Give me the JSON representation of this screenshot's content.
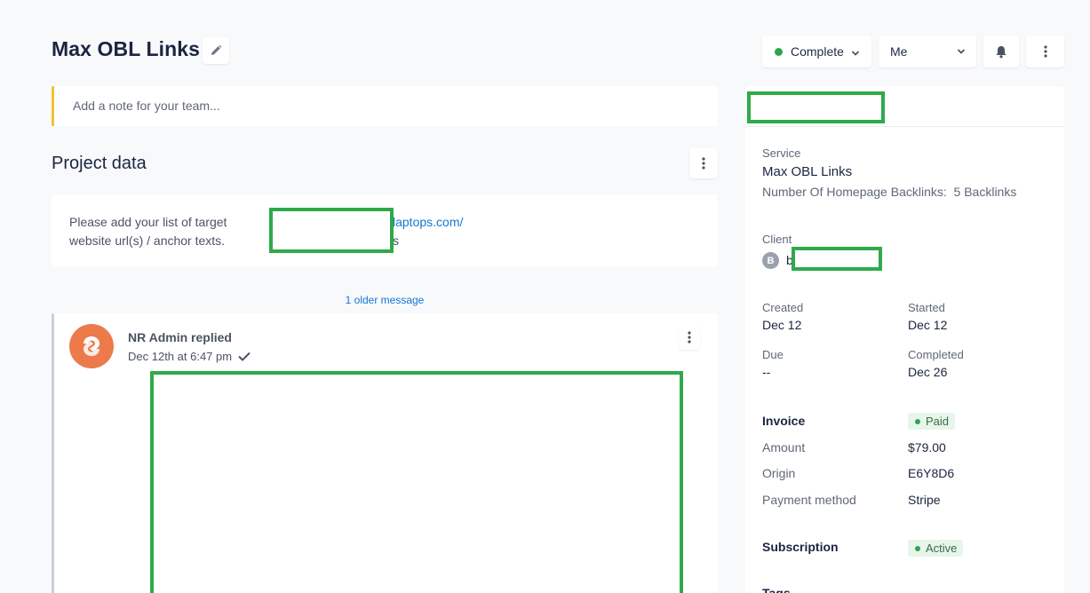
{
  "header": {
    "title": "Max OBL Links",
    "status_label": "Complete",
    "assignee_label": "Me"
  },
  "note": {
    "placeholder": "Add a note for your team..."
  },
  "project": {
    "title": "Project data",
    "question": "Please add your list of target website url(s) / anchor texts.",
    "answer_link_tail": "laptops.com/",
    "answer_line2_tail": "s"
  },
  "thread": {
    "older_label": "1 older message",
    "author": "NR Admin replied",
    "time": "Dec 12th at 6:47 pm"
  },
  "sidebar": {
    "service_label": "Service",
    "service_name": "Max OBL Links",
    "service_option": "Number Of Homepage Backlinks:  5 Backlinks",
    "client_label": "Client",
    "client_initial": "B",
    "client_name_start": "b",
    "created_label": "Created",
    "created_value": "Dec 12",
    "started_label": "Started",
    "started_value": "Dec 12",
    "due_label": "Due",
    "due_value": "--",
    "completed_label": "Completed",
    "completed_value": "Dec 26",
    "invoice_label": "Invoice",
    "invoice_status": "Paid",
    "amount_label": "Amount",
    "amount_value": "$79.00",
    "origin_label": "Origin",
    "origin_value": "E6Y8D6",
    "payment_label": "Payment method",
    "payment_value": "Stripe",
    "subscription_label": "Subscription",
    "subscription_status": "Active",
    "tags_label": "Tags"
  },
  "colors": {
    "status_green": "#2ea44f",
    "link_blue": "#1477d4",
    "note_accent": "#f2c230",
    "redaction_green": "#2eaa4b",
    "avatar_orange": "#ec7a4a"
  }
}
